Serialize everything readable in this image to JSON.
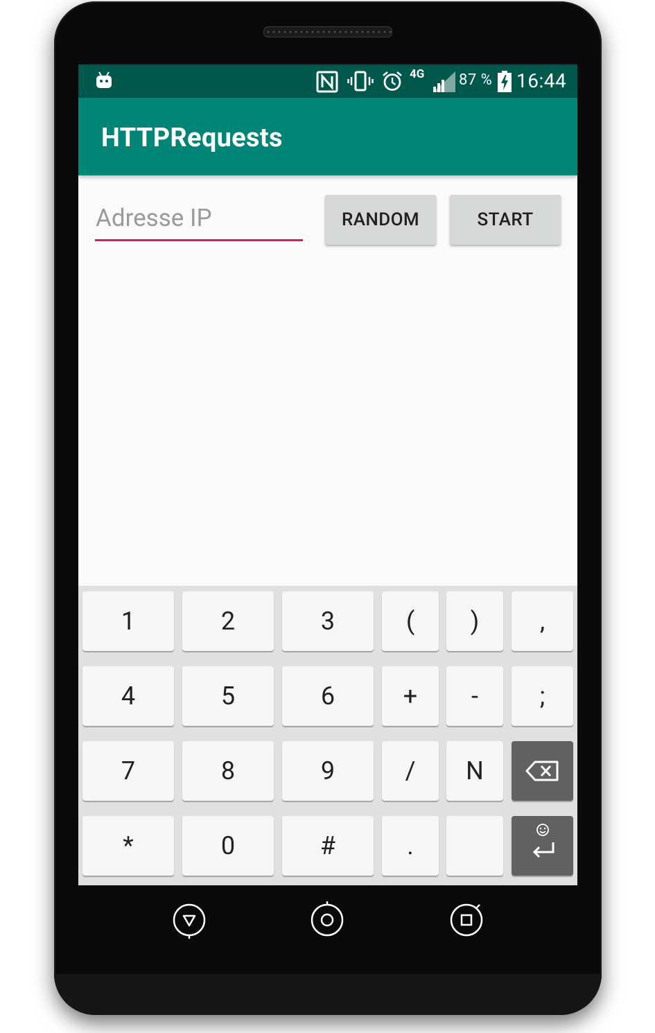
{
  "status_bar": {
    "network_type": "4G",
    "battery_percent": "87 %",
    "time": "16:44",
    "icons": [
      "android-debug-icon",
      "nfc-icon",
      "vibrate-icon",
      "alarm-icon",
      "cell-signal-icon",
      "battery-charging-icon"
    ]
  },
  "app_bar": {
    "title": "HTTPRequests"
  },
  "form": {
    "ip_placeholder": "Adresse IP",
    "ip_value": "",
    "random_label": "RANDOM",
    "start_label": "START"
  },
  "keyboard": {
    "rows": [
      [
        "1",
        "2",
        "3",
        "(",
        ")",
        ","
      ],
      [
        "4",
        "5",
        "6",
        "+",
        "-",
        ";"
      ],
      [
        "7",
        "8",
        "9",
        "/",
        "N",
        "backspace"
      ],
      [
        "*",
        "0",
        "#",
        ".",
        "space",
        "enter"
      ]
    ]
  },
  "navigation": {
    "icons": [
      "back-icon",
      "home-icon",
      "recents-icon"
    ]
  },
  "colors": {
    "status_bar": "#00574b",
    "app_bar": "#008577",
    "accent": "#d81b60",
    "button": "#d6d7d7",
    "keyboard_bg": "#e0e0e0",
    "key_dark": "#616161"
  }
}
